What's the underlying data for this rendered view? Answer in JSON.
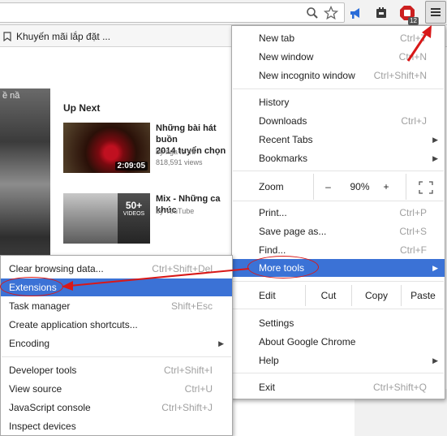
{
  "bookmarks_bar": {
    "item_label": "Khuyến mãi lắp đặt ..."
  },
  "toolbar": {
    "badge_count": "12"
  },
  "page": {
    "left_caption": "ề nầ",
    "up_next_label": "Up Next",
    "videos": [
      {
        "title": "Những bài hát buồn\n2014 tuyển chọn",
        "channel": "by nga le thi",
        "views": "818,591 views",
        "duration": "2:09:05"
      },
      {
        "title": "Mix - Những ca khúc",
        "channel": "by YouTube",
        "playlist_count": "50+",
        "playlist_label": "VIDEOS"
      }
    ]
  },
  "chrome_menu": {
    "new_tab": "New tab",
    "new_tab_sc": "Ctrl+T",
    "new_window": "New window",
    "new_window_sc": "Ctrl+N",
    "new_incognito": "New incognito window",
    "new_incognito_sc": "Ctrl+Shift+N",
    "history": "History",
    "downloads": "Downloads",
    "downloads_sc": "Ctrl+J",
    "recent_tabs": "Recent Tabs",
    "bookmarks": "Bookmarks",
    "zoom_label": "Zoom",
    "zoom_minus": "–",
    "zoom_value": "90%",
    "zoom_plus": "+",
    "print": "Print...",
    "print_sc": "Ctrl+P",
    "save_page": "Save page as...",
    "save_page_sc": "Ctrl+S",
    "find": "Find...",
    "find_sc": "Ctrl+F",
    "more_tools": "More tools",
    "edit_label": "Edit",
    "cut": "Cut",
    "copy": "Copy",
    "paste": "Paste",
    "settings": "Settings",
    "about": "About Google Chrome",
    "help": "Help",
    "exit": "Exit",
    "exit_sc": "Ctrl+Shift+Q"
  },
  "more_tools_menu": {
    "clear_browsing": "Clear browsing data...",
    "clear_browsing_sc": "Ctrl+Shift+Del",
    "extensions": "Extensions",
    "task_manager": "Task manager",
    "task_manager_sc": "Shift+Esc",
    "create_shortcuts": "Create application shortcuts...",
    "encoding": "Encoding",
    "developer_tools": "Developer tools",
    "developer_tools_sc": "Ctrl+Shift+I",
    "view_source": "View source",
    "view_source_sc": "Ctrl+U",
    "js_console": "JavaScript console",
    "js_console_sc": "Ctrl+Shift+J",
    "inspect_devices": "Inspect devices"
  },
  "colors": {
    "highlight": "#3b72d6",
    "annotation_red": "#d81818"
  },
  "icons": [
    "search-icon",
    "star-icon",
    "megaphone-icon",
    "extension-icon",
    "adblock-icon",
    "hamburger-menu-icon",
    "submenu-arrow-icon",
    "fullscreen-icon"
  ]
}
